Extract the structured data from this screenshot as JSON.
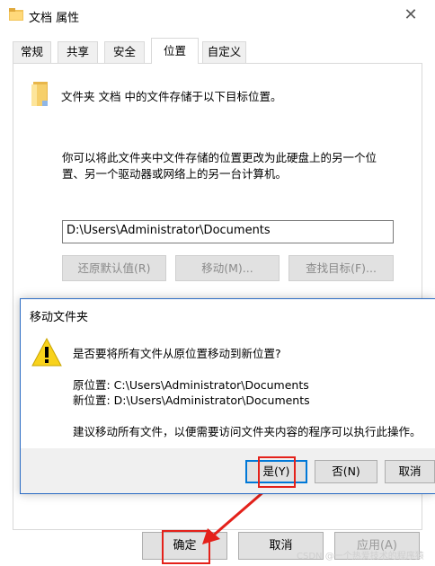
{
  "window": {
    "title": "文档 属性",
    "close_symbol": "✕",
    "tabs": [
      {
        "label": "常规"
      },
      {
        "label": "共享"
      },
      {
        "label": "安全"
      },
      {
        "label": "位置"
      },
      {
        "label": "自定义"
      }
    ],
    "active_tab": "位置"
  },
  "location": {
    "intro": "文件夹 文档 中的文件存储于以下目标位置。",
    "desc_line1": "你可以将此文件夹中文件存储的位置更改为此硬盘上的另一个位",
    "desc_line2": "置、另一个驱动器或网络上的另一台计算机。",
    "path_value": "D:\\Users\\Administrator\\Documents",
    "restore_default": "还原默认值(R)",
    "move": "移动(M)...",
    "find_target": "查找目标(F)..."
  },
  "footer": {
    "ok": "确定",
    "cancel": "取消",
    "apply": "应用(A)"
  },
  "dialog": {
    "title": "移动文件夹",
    "question": "是否要将所有文件从原位置移动到新位置?",
    "orig_label": "原位置: C:\\Users\\Administrator\\Documents",
    "new_label": "新位置: D:\\Users\\Administrator\\Documents",
    "advice": "建议移动所有文件，以便需要访问文件夹内容的程序可以执行此操作。",
    "yes": "是(Y)",
    "no": "否(N)",
    "cancel": "取消"
  },
  "watermark": "CSDN @一个热爱技术的程序猿",
  "colors": {
    "accent_blue": "#0078d7",
    "highlight_red": "#e4211a",
    "warning_yellow": "#f8d21c"
  },
  "icons": [
    "folder-icon",
    "warning-icon",
    "close-icon",
    "red-arrow"
  ]
}
